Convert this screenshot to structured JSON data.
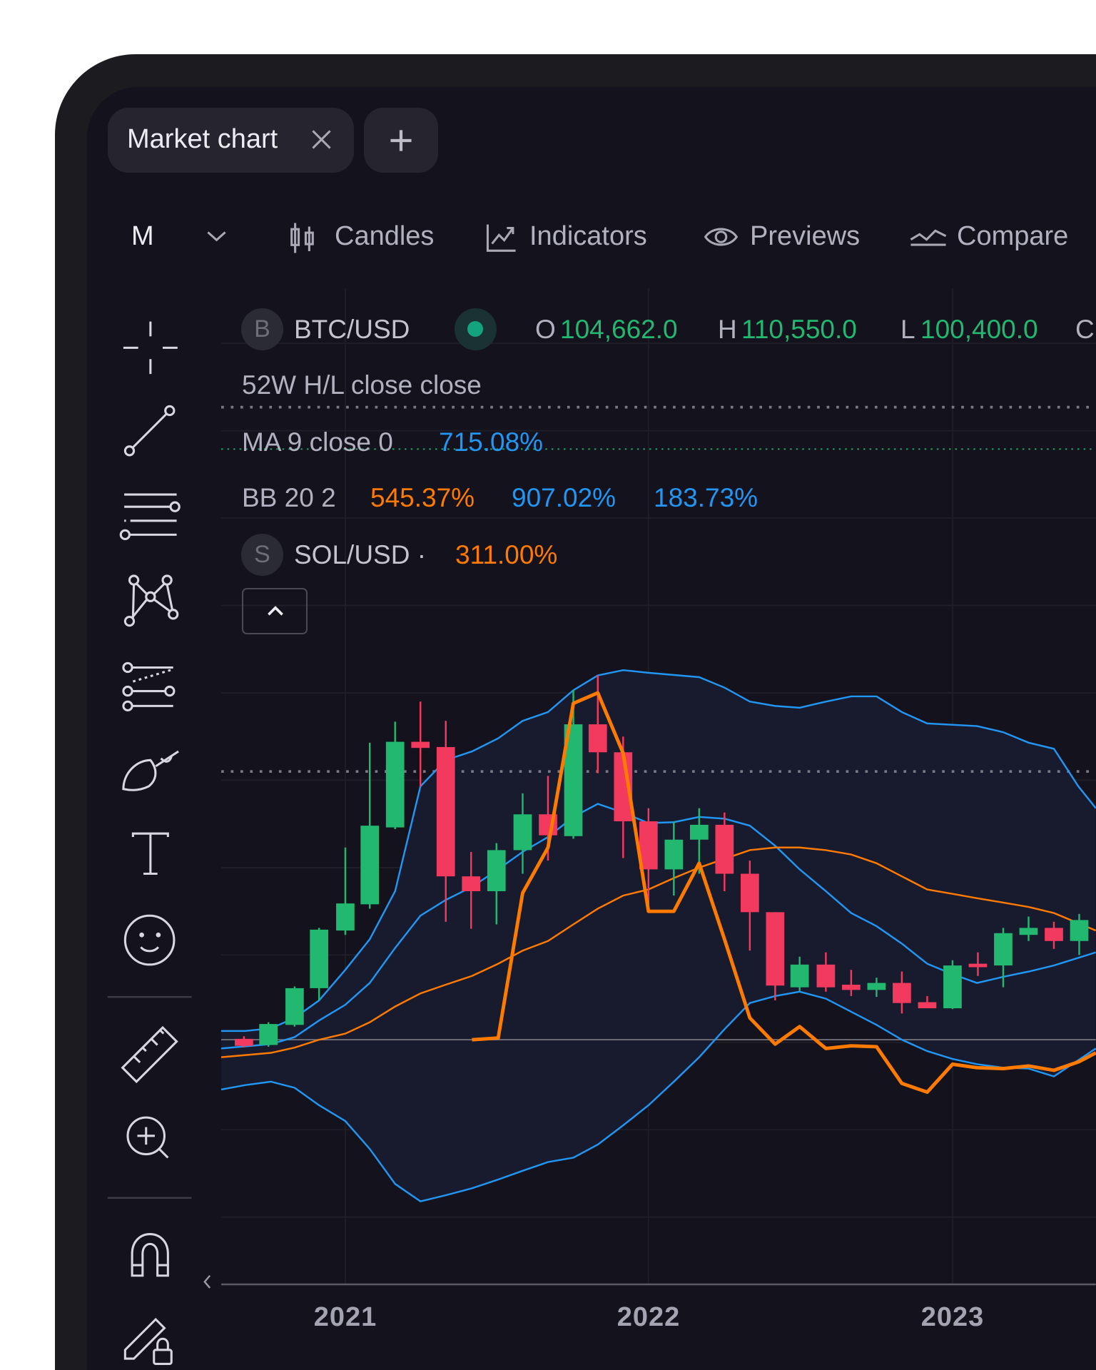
{
  "tabs": [
    {
      "label": "Market chart",
      "close_icon": "close-icon"
    }
  ],
  "new_tab_icon": "plus-icon",
  "toolbar": {
    "interval": "M",
    "candles": "Candles",
    "indicators": "Indicators",
    "previews": "Previews",
    "compare": "Compare"
  },
  "legend": {
    "symbol_badge": "B",
    "symbol": "BTC/USD",
    "ohlc": {
      "o_label": "O",
      "o": "104,662.0",
      "h_label": "H",
      "h": "110,550.0",
      "l_label": "L",
      "l": "100,400.0",
      "c_label": "C"
    },
    "hl52": "52W H/L close close",
    "ma_label": "MA 9 close 0",
    "ma_value": "715.08%",
    "bb_label": "BB 20 2",
    "bb_basis": "545.37%",
    "bb_upper": "907.02%",
    "bb_lower": "183.73%",
    "compare_badge": "S",
    "compare_symbol": "SOL/USD ·",
    "compare_value": "311.00%"
  },
  "x_axis": {
    "ticks": [
      "2021",
      "2022",
      "2023"
    ]
  },
  "colors": {
    "up": "#22b86f",
    "down": "#f23a5e",
    "bb": "#2196f3",
    "ma": "#ff7b00",
    "compare": "#ff7b00",
    "background": "#14121d"
  },
  "tools": [
    "crosshair-icon",
    "trend-line-icon",
    "horizontal-lines-icon",
    "pattern-icon",
    "fib-icon",
    "brush-icon",
    "text-icon",
    "emoji-icon",
    "ruler-icon",
    "zoom-in-icon",
    "magnet-icon",
    "lock-drawings-icon"
  ]
}
